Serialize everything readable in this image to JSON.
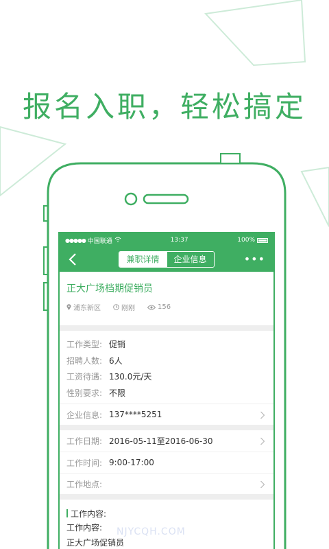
{
  "headline": "报名入职，轻松搞定",
  "status_bar": {
    "carrier": "中国联通",
    "time": "13:37",
    "battery": "100%"
  },
  "nav": {
    "tab_detail": "兼职详情",
    "tab_company": "企业信息",
    "more": "•••"
  },
  "job": {
    "title": "正大广场档期促销员",
    "location": "浦东新区",
    "posted": "刚刚",
    "views": "156"
  },
  "details": [
    {
      "label": "工作类型:",
      "value": "促销"
    },
    {
      "label": "招聘人数:",
      "value": "6人"
    },
    {
      "label": "工资待遇:",
      "value": "130.0元/天"
    },
    {
      "label": "性别要求:",
      "value": "不限"
    }
  ],
  "company": {
    "label": "企业信息:",
    "value": "137****5251"
  },
  "schedule": {
    "date_label": "工作日期:",
    "date_value": "2016-05-11至2016-06-30",
    "time_label": "工作时间:",
    "time_value": "9:00-17:00",
    "place_label": "工作地点:",
    "place_value": ""
  },
  "content": {
    "heading": "工作内容:",
    "line1": "工作内容:",
    "line2": "正大广场促销员"
  },
  "watermark": "NJYCQH.COM",
  "colors": {
    "accent": "#3fae62"
  }
}
